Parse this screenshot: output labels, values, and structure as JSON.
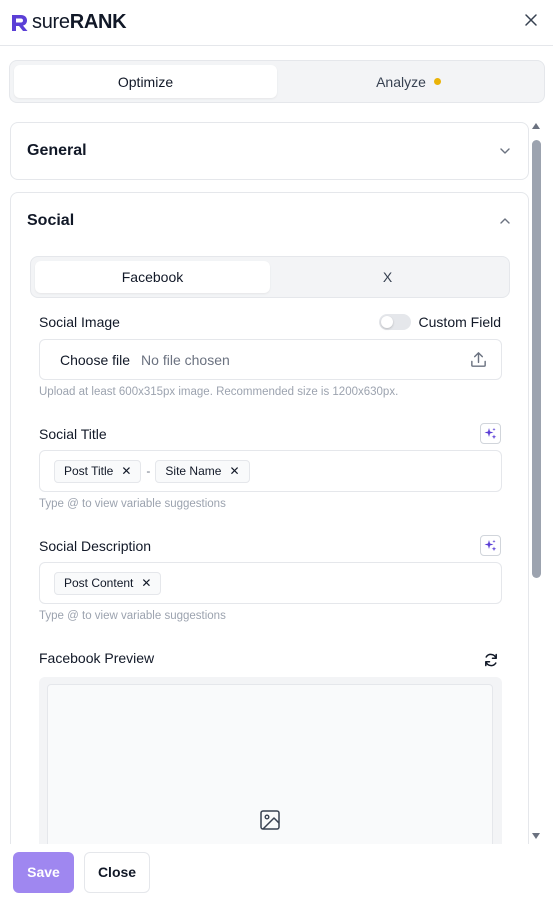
{
  "colors": {
    "brand": "#5b3fd6",
    "save_button": "#9f87f0",
    "analyze_dot": "#eab308"
  },
  "header": {
    "logo_light": "sure",
    "logo_bold": "RANK",
    "close_icon": "close-icon"
  },
  "main_tabs": [
    {
      "label": "Optimize",
      "active": true
    },
    {
      "label": "Analyze",
      "active": false,
      "indicator": "dot"
    }
  ],
  "sections": {
    "general": {
      "title": "General",
      "expanded": false
    },
    "social": {
      "title": "Social",
      "expanded": true
    }
  },
  "social_tabs": [
    {
      "label": "Facebook",
      "active": true
    },
    {
      "label": "X",
      "active": false
    }
  ],
  "social_image": {
    "label": "Social Image",
    "toggle_label": "Custom Field",
    "toggle_on": false,
    "choose_file": "Choose file",
    "no_file": "No file chosen",
    "hint": "Upload at least 600x315px image. Recommended size is 1200x630px."
  },
  "social_title": {
    "label": "Social Title",
    "tags": [
      "Post Title",
      "Site Name"
    ],
    "separator": "-",
    "hint": "Type @ to view variable suggestions"
  },
  "social_description": {
    "label": "Social Description",
    "tags": [
      "Post Content"
    ],
    "hint": "Type @ to view variable suggestions"
  },
  "facebook_preview": {
    "label": "Facebook Preview"
  },
  "footer": {
    "save": "Save",
    "close": "Close"
  }
}
